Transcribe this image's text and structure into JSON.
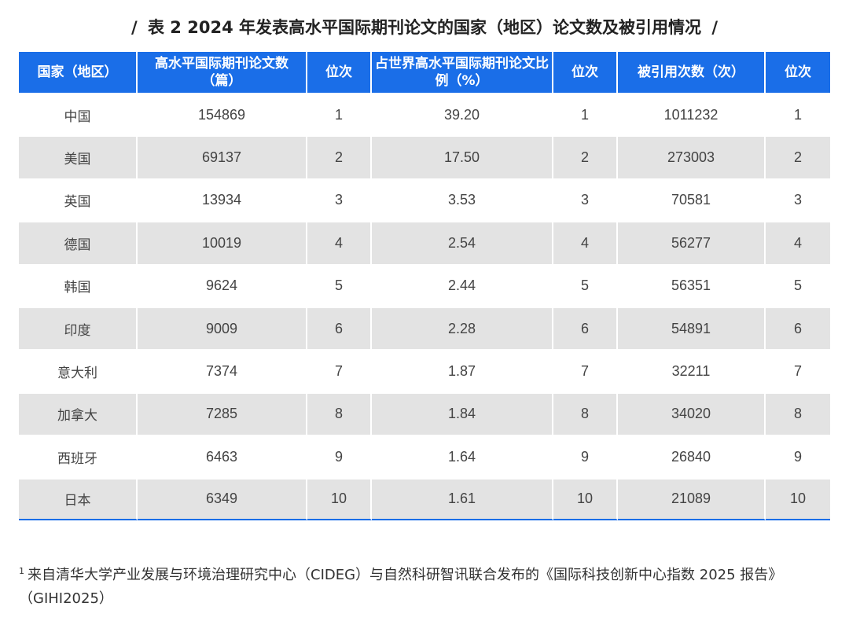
{
  "title": "表 2 2024 年发表高水平国际期刊论文的国家（地区）论文数及被引用情况",
  "title_slash_left": "/",
  "title_slash_right": "/",
  "colors": {
    "header_bg": "#1a6ee8",
    "row_alt_bg": "#e3e3e3",
    "header_text": "#ffffff"
  },
  "table": {
    "headers": [
      "国家（地区）",
      "高水平国际期刊论文数（篇）",
      "位次",
      "占世界高水平国际期刊论文比例（%）",
      "位次",
      "被引用次数（次）",
      "位次"
    ],
    "rows": [
      [
        "中国",
        "154869",
        "1",
        "39.20",
        "1",
        "1011232",
        "1"
      ],
      [
        "美国",
        "69137",
        "2",
        "17.50",
        "2",
        "273003",
        "2"
      ],
      [
        "英国",
        "13934",
        "3",
        "3.53",
        "3",
        "70581",
        "3"
      ],
      [
        "德国",
        "10019",
        "4",
        "2.54",
        "4",
        "56277",
        "4"
      ],
      [
        "韩国",
        "9624",
        "5",
        "2.44",
        "5",
        "56351",
        "5"
      ],
      [
        "印度",
        "9009",
        "6",
        "2.28",
        "6",
        "54891",
        "6"
      ],
      [
        "意大利",
        "7374",
        "7",
        "1.87",
        "7",
        "32211",
        "7"
      ],
      [
        "加拿大",
        "7285",
        "8",
        "1.84",
        "8",
        "34020",
        "8"
      ],
      [
        "西班牙",
        "6463",
        "9",
        "1.64",
        "9",
        "26840",
        "9"
      ],
      [
        "日本",
        "6349",
        "10",
        "1.61",
        "10",
        "21089",
        "10"
      ]
    ]
  },
  "footnote": {
    "marker": "1",
    "text": "来自清华大学产业发展与环境治理研究中心（CIDEG）与自然科研智讯联合发布的《国际科技创新中心指数 2025 报告》（GIHI2025）"
  }
}
